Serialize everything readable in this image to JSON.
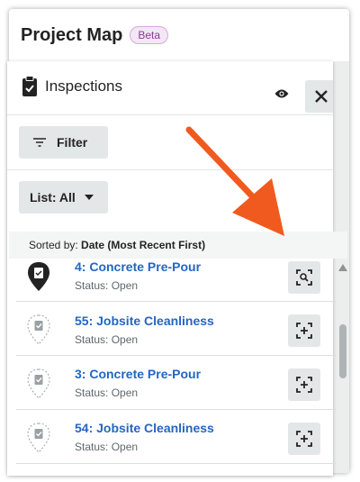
{
  "app": {
    "title": "Project Map",
    "badge": "Beta"
  },
  "panel": {
    "title": "Inspections",
    "title_icon": "clipboard-icon",
    "filter_label": "Filter",
    "list_label": "List: All",
    "sorted_prefix": "Sorted by:",
    "sorted_value": "Date (Most Recent First)"
  },
  "inspections": [
    {
      "title": "4: Concrete Pre-Pour",
      "status": "Status: Open",
      "pin": "active",
      "action_icon": "zoom-to-location-icon"
    },
    {
      "title": "55: Jobsite Cleanliness",
      "status": "Status: Open",
      "pin": "outline",
      "action_icon": "place-on-map-icon"
    },
    {
      "title": "3: Concrete Pre-Pour",
      "status": "Status: Open",
      "pin": "outline",
      "action_icon": "place-on-map-icon"
    },
    {
      "title": "54: Jobsite Cleanliness",
      "status": "Status: Open",
      "pin": "outline",
      "action_icon": "place-on-map-icon"
    }
  ],
  "colors": {
    "link": "#2466c1",
    "arrow": "#f15a1f",
    "badge": "#8a3a95"
  }
}
